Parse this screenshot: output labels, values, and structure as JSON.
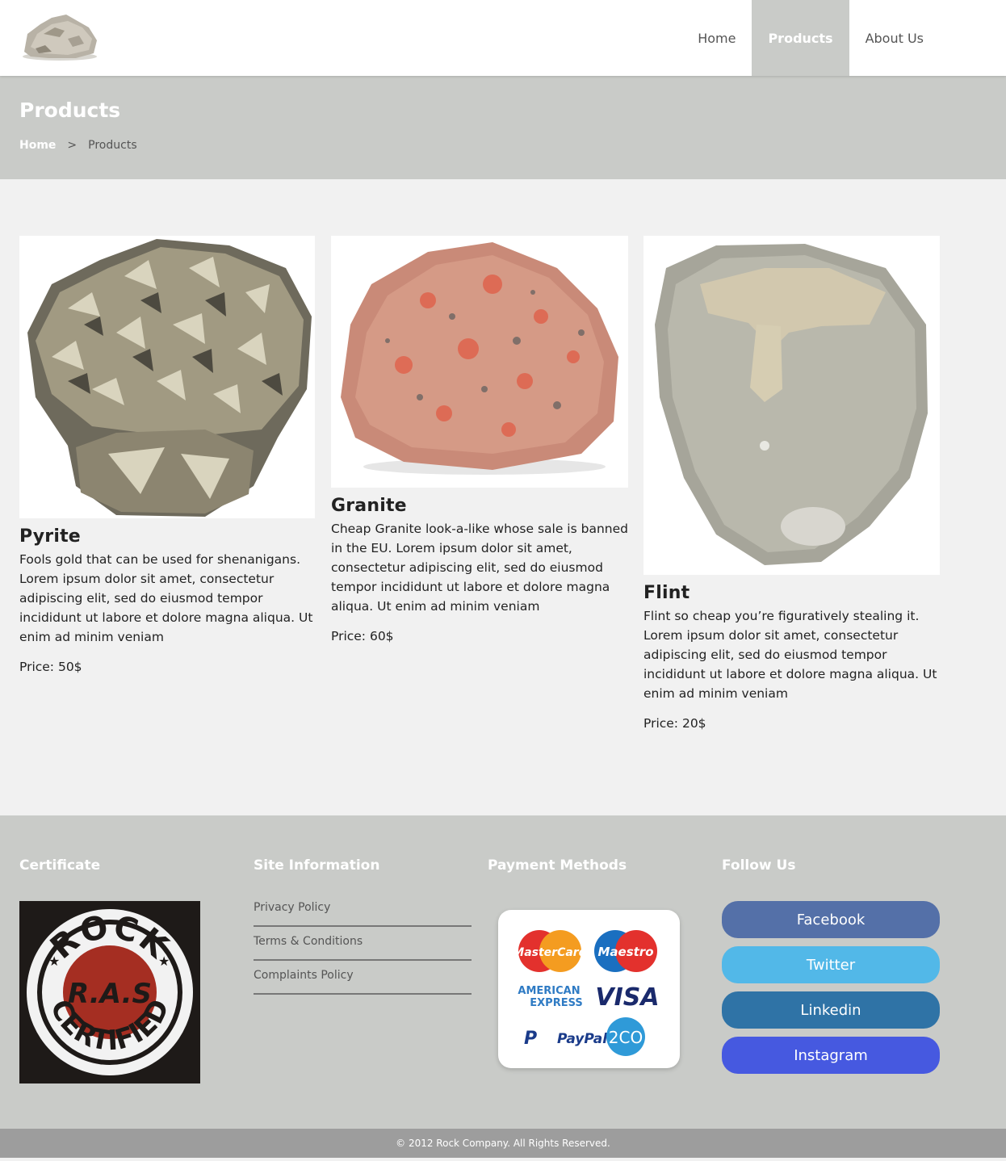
{
  "header": {
    "logo_icon": "rock-logo-icon",
    "nav": [
      {
        "label": "Home"
      },
      {
        "label": "Products"
      },
      {
        "label": "About Us"
      }
    ]
  },
  "hero": {
    "title": "Products",
    "breadcrumb": {
      "home": "Home",
      "separator": ">",
      "current": "Products"
    }
  },
  "products": [
    {
      "name": "Pyrite",
      "description": "Fools gold that can be used for shenanigans. Lorem ipsum dolor sit amet, consectetur adipiscing elit, sed do eiusmod tempor incididunt ut labore et dolore magna aliqua. Ut enim ad minim veniam",
      "price": "Price: 50$",
      "image": "pyrite-image"
    },
    {
      "name": "Granite",
      "description": "Cheap Granite look-a-like whose sale is banned in the EU. Lorem ipsum dolor sit amet, consectetur adipiscing elit, sed do eiusmod tempor incididunt ut labore et dolore magna aliqua. Ut enim ad minim veniam",
      "price": "Price: 60$",
      "image": "granite-image"
    },
    {
      "name": "Flint",
      "description": "Flint so cheap you’re figuratively stealing it. Lorem ipsum dolor sit amet, consectetur adipiscing elit, sed do eiusmod tempor incididunt ut labore et dolore magna aliqua. Ut enim ad minim veniam",
      "price": "Price: 20$",
      "image": "flint-image"
    }
  ],
  "footer": {
    "certificate": {
      "title": "Certificate",
      "badge_top": "ROCK",
      "badge_center": "R.A.S",
      "badge_bottom": "CERTIFIED"
    },
    "site_info": {
      "title": "Site Information",
      "links": [
        "Privacy Policy",
        "Terms & Conditions",
        "Complaints Policy"
      ]
    },
    "payments": {
      "title": "Payment Methods",
      "logos": [
        "MasterCard",
        "Maestro",
        "AMERICAN",
        "EXPRESS",
        "VISA",
        "PayPal",
        "2CO"
      ]
    },
    "follow": {
      "title": "Follow Us",
      "buttons": [
        {
          "label": "Facebook",
          "color": "#5470a8"
        },
        {
          "label": "Twitter",
          "color": "#52b8e8"
        },
        {
          "label": "Linkedin",
          "color": "#2f73a6"
        },
        {
          "label": "Instagram",
          "color": "#4659e0"
        }
      ]
    }
  },
  "copyright": "© 2012 Rock Company. All Rights Reserved."
}
